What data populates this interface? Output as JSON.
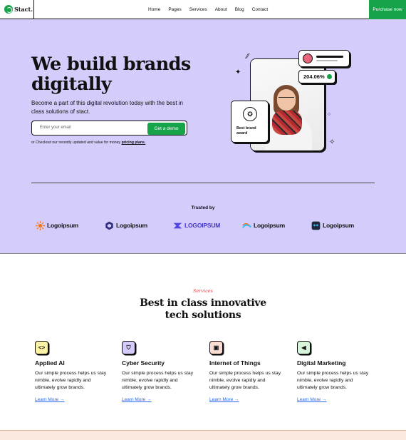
{
  "nav": {
    "brand": "Stact.",
    "items": [
      "Home",
      "Pages",
      "Services",
      "About",
      "Blog",
      "Contact"
    ],
    "cta": "Purchase now"
  },
  "hero": {
    "title": "We build brands digitally",
    "subtitle": "Become a part of this digital revolution today with the best in class solutions of stact.",
    "email_placeholder": "Enter your email",
    "demo_button": "Get a demo",
    "note_prefix": "or Checkout our recently updated and value for money",
    "note_link": "pricing plans.",
    "stat_value": "204.06%",
    "award_text": "Best brand award",
    "trusted_label": "Trusted by",
    "logos": [
      "Logoipsum",
      "Logoipsum",
      "LOGOIPSUM",
      "Logoipsum",
      "Logoipsum"
    ]
  },
  "services": {
    "label": "Services",
    "title": "Best in class innovative tech solutions",
    "cards": [
      {
        "icon": "code-icon",
        "title": "Applied AI",
        "text": "Our simple process helps us stay nimble, evolve rapidly and ultimately grow brands.",
        "link": "Learn More",
        "color": "#fdf3a7"
      },
      {
        "icon": "shield-icon",
        "title": "Cyber Security",
        "text": "Our simple process helps us stay nimble, evolve rapidly and ultimately grow brands.",
        "link": "Learn More",
        "color": "#d6ccfb"
      },
      {
        "icon": "chip-icon",
        "title": "Internet of Things",
        "text": "Our simple process helps us stay nimble, evolve rapidly and ultimately grow brands.",
        "link": "Learn More",
        "color": "#fbdcd3"
      },
      {
        "icon": "megaphone-icon",
        "title": "Digital Marketing",
        "text": "Our simple process helps us stay nimble, evolve rapidly and ultimately grow brands.",
        "link": "Learn More",
        "color": "#d8f5dc"
      }
    ]
  },
  "colors": {
    "accent": "#17a34a",
    "hero_bg": "#d4ccfb",
    "link": "#2563eb",
    "services_label": "#e0464c"
  }
}
